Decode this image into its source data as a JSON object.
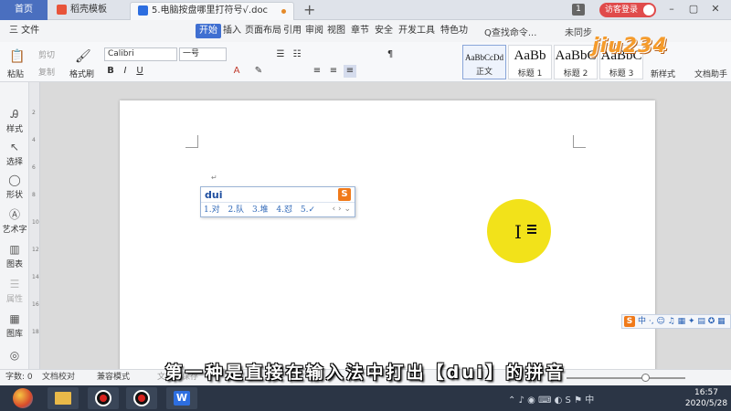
{
  "tabs": {
    "home": "首页",
    "templates": "稻壳模板",
    "document": "5.电脑按盘哪里打符号√.doc",
    "new_tab": "+",
    "window_count": "1",
    "visitor_login": "访客登录"
  },
  "menu": {
    "file": "三 文件",
    "items": [
      "开始",
      "插入",
      "页面布局",
      "引用",
      "审阅",
      "视图",
      "章节",
      "安全",
      "开发工具",
      "特色功"
    ],
    "search": "Q查找命令...",
    "sync": "未同步"
  },
  "ribbon": {
    "cut": "剪切",
    "copy": "复制",
    "paste": "粘贴",
    "format_painter": "格式刷",
    "font_name": "Calibri",
    "font_size": "一号",
    "styles": [
      {
        "sample": "AaBbCcDd",
        "name": "正文"
      },
      {
        "sample": "AaBb",
        "name": "标题 1"
      },
      {
        "sample": "AaBbC",
        "name": "标题 2"
      },
      {
        "sample": "AaBbC",
        "name": "标题 3"
      }
    ],
    "new_style": "新样式",
    "doc_helper": "文档助手"
  },
  "left_panel": [
    "样式",
    "选择",
    "形状",
    "艺术字",
    "图表",
    "属性",
    "图库"
  ],
  "ruler_ticks": [
    "2",
    "4",
    "6",
    "8",
    "10",
    "12",
    "14",
    "16",
    "18"
  ],
  "ime_popup": {
    "input": "dui",
    "logo": "S",
    "candidates": [
      "1.对",
      "2.队",
      "3.堆",
      "4.怼",
      "5.✓"
    ],
    "nav": "‹ › ⌄"
  },
  "ime_status_bar": {
    "logo": "S",
    "text": "中 ·, ☺ ♫ ▦ ✦ ▤ ✪ ▦"
  },
  "subtitle": "第一种是直接在输入法中打出【dui】的拼音",
  "status_bar": {
    "word_count": "字数: 0",
    "proofread": "文档校对",
    "compat_mode": "兼容模式",
    "unsaved": "文档未保存"
  },
  "taskbar": {
    "wps_label": "W",
    "tray": "⌃ ♪ ◉ ⌨ ◐ S ⚑ 中",
    "time": "16:57",
    "date": "2020/5/28"
  },
  "watermark": "jiu234",
  "colors": {
    "accent": "#3f6fd1",
    "spotlight": "#f2e21a",
    "visitor_button": "#e04b4b",
    "ime_orange": "#f07a1a"
  }
}
